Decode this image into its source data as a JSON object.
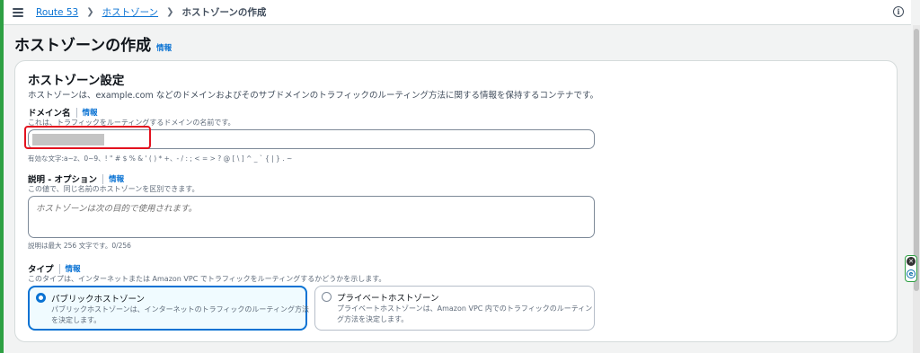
{
  "breadcrumb": {
    "items": [
      "Route 53",
      "ホストゾーン"
    ],
    "current": "ホストゾーンの作成"
  },
  "page": {
    "title": "ホストゾーンの作成",
    "info_label": "情報"
  },
  "settings": {
    "title": "ホストゾーン設定",
    "description": "ホストゾーンは、example.com などのドメインおよびそのサブドメインのトラフィックのルーティング方法に関する情報を保持するコンテナです。"
  },
  "domain": {
    "label": "ドメイン名",
    "info": "情報",
    "description": "これは、トラフィックをルーティングするドメインの名前です。",
    "value": "",
    "constraint": "有効な文字:a~z、0~9、! \" # $ % & ' ( ) * +、- / : ; < = > ? @ [ \\ ] ^ _ ` { | } . ~"
  },
  "comment": {
    "label": "説明 - オプション",
    "info": "情報",
    "description": "この値で、同じ名前のホストゾーンを区別できます。",
    "placeholder": "ホストゾーンは次の目的で使用されます。",
    "constraint": "説明は最大 256 文字です。0/256"
  },
  "type": {
    "label": "タイプ",
    "info": "情報",
    "description": "このタイプは、インターネットまたは Amazon VPC でトラフィックをルーティングするかどうかを示します。",
    "options": [
      {
        "title": "パブリックホストゾーン",
        "description": "パブリックホストゾーンは、インターネットのトラフィックのルーティング方法を決定します。",
        "selected": true
      },
      {
        "title": "プライベートホストゾーン",
        "description": "プライベートホストゾーンは、Amazon VPC 内でのトラフィックのルーティング方法を決定します。",
        "selected": false
      }
    ]
  },
  "icons": {
    "menu": "hamburger-menu-icon",
    "info": "info-circle-icon",
    "close": "close-icon",
    "extension": "extension-e-icon"
  },
  "colors": {
    "accent": "#0972d3",
    "highlight": "#e3121f"
  }
}
